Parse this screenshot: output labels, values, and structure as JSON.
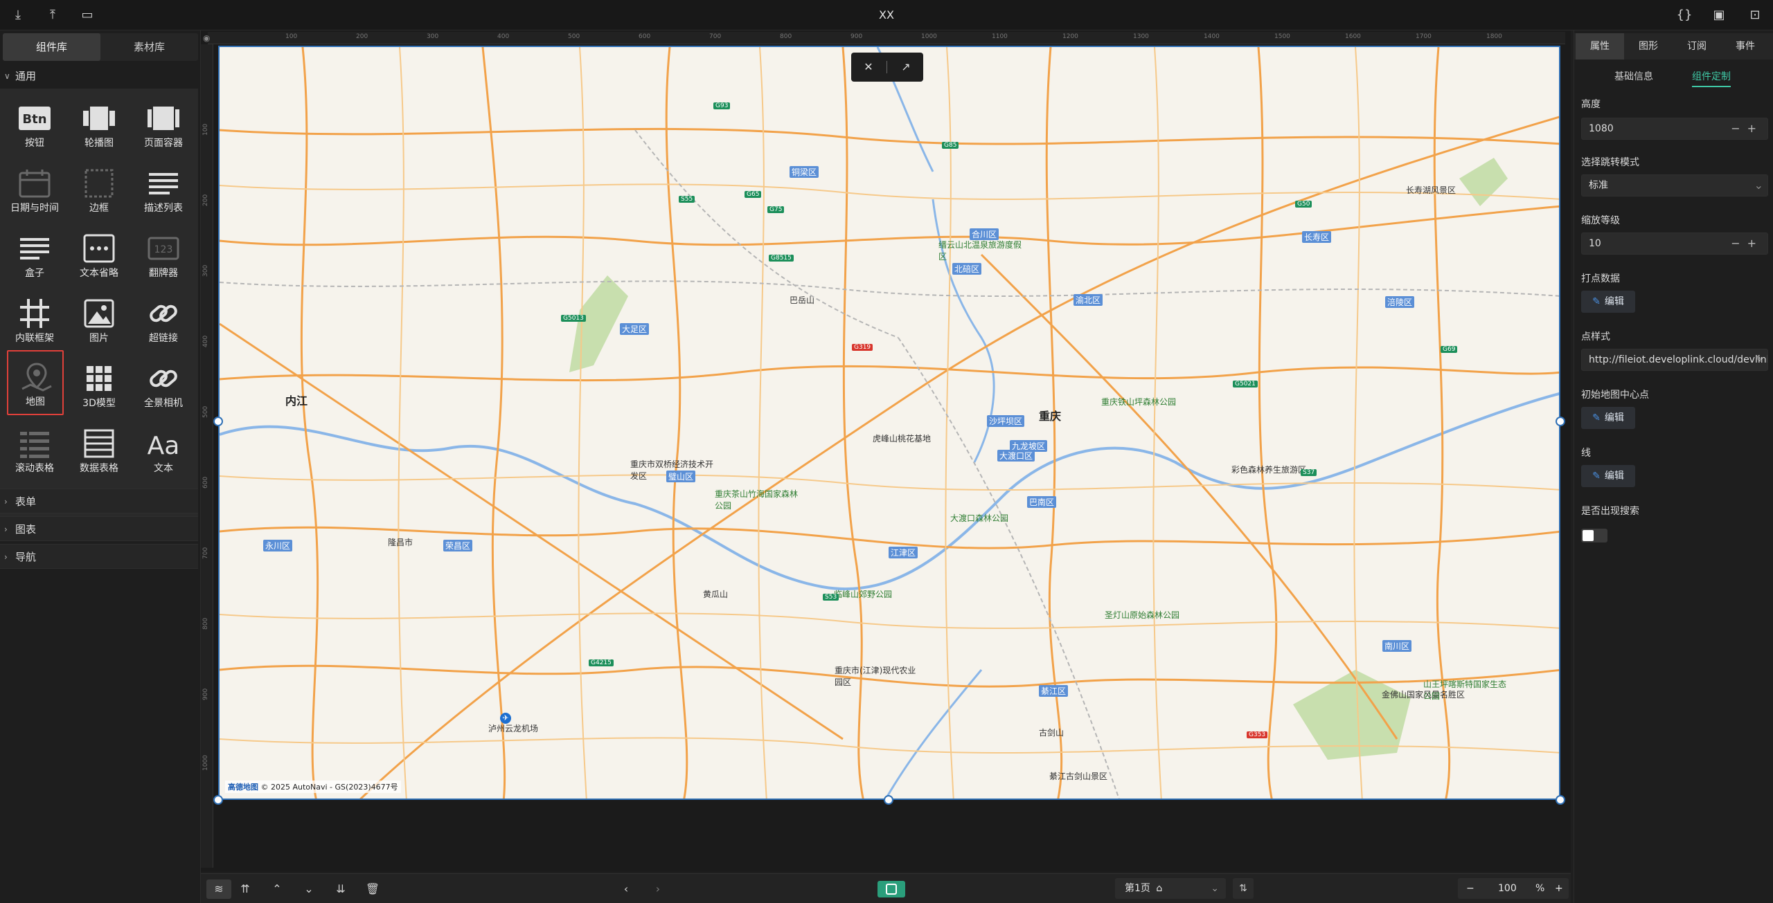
{
  "app": {
    "title": "XX"
  },
  "topbar": {
    "left_icons": [
      "download-icon",
      "upload-icon",
      "monitor-icon"
    ],
    "right_icons": [
      "code-icon",
      "save-icon",
      "export-icon"
    ]
  },
  "left_panel": {
    "tabs": [
      {
        "label": "组件库",
        "active": true
      },
      {
        "label": "素材库",
        "active": false
      }
    ],
    "sections": [
      {
        "label": "通用",
        "expanded": true
      },
      {
        "label": "表单",
        "expanded": false
      },
      {
        "label": "图表",
        "expanded": false
      },
      {
        "label": "导航",
        "expanded": false
      }
    ],
    "components": [
      {
        "label": "按钮",
        "icon": "btn-icon"
      },
      {
        "label": "轮播图",
        "icon": "carousel-icon"
      },
      {
        "label": "页面容器",
        "icon": "page-container-icon"
      },
      {
        "label": "日期与时间",
        "icon": "calendar-icon"
      },
      {
        "label": "边框",
        "icon": "border-icon"
      },
      {
        "label": "描述列表",
        "icon": "description-list-icon"
      },
      {
        "label": "盒子",
        "icon": "box-icon"
      },
      {
        "label": "文本省略",
        "icon": "ellipsis-icon"
      },
      {
        "label": "翻牌器",
        "icon": "flip-counter-icon"
      },
      {
        "label": "内联框架",
        "icon": "iframe-icon"
      },
      {
        "label": "图片",
        "icon": "image-icon"
      },
      {
        "label": "超链接",
        "icon": "link-icon"
      },
      {
        "label": "地图",
        "icon": "map-icon"
      },
      {
        "label": "3D模型",
        "icon": "grid-3d-icon"
      },
      {
        "label": "全景相机",
        "icon": "panorama-link-icon"
      },
      {
        "label": "滚动表格",
        "icon": "scroll-table-icon"
      },
      {
        "label": "数据表格",
        "icon": "data-table-icon"
      },
      {
        "label": "文本",
        "icon": "text-icon"
      }
    ]
  },
  "ruler": {
    "top_marks": [
      "100",
      "200",
      "300",
      "400",
      "500",
      "600",
      "700",
      "800",
      "900",
      "1000",
      "1100",
      "1200",
      "1300",
      "1400",
      "1500",
      "1600",
      "1700",
      "1800"
    ],
    "left_marks": [
      "100",
      "200",
      "300",
      "400",
      "500",
      "600",
      "700",
      "800",
      "900",
      "1000"
    ]
  },
  "map": {
    "attribution_logo": "高德地图",
    "attribution_text": "© 2025 AutoNavi - GS(2023)4677号",
    "toolbar_icons": [
      "no-flash-icon",
      "trend-icon"
    ],
    "places": [
      {
        "name": "重庆",
        "big": true
      },
      {
        "name": "内江",
        "big": true
      },
      {
        "name": "铜梁区"
      },
      {
        "name": "北碚区"
      },
      {
        "name": "合川区"
      },
      {
        "name": "永川区"
      },
      {
        "name": "沙坪坝区"
      },
      {
        "name": "九龙坡区"
      },
      {
        "name": "大渡口区"
      },
      {
        "name": "巴南区"
      },
      {
        "name": "江津区"
      },
      {
        "name": "渝北区"
      },
      {
        "name": "长寿区"
      },
      {
        "name": "涪陵区"
      },
      {
        "name": "南川区"
      },
      {
        "name": "大足区"
      },
      {
        "name": "璧山区"
      },
      {
        "name": "綦江区"
      },
      {
        "name": "荣昌区"
      },
      {
        "name": "隆昌市"
      },
      {
        "name": "泸州云龙机场"
      },
      {
        "name": "缙云山北温泉旅游度假区",
        "park": true
      },
      {
        "name": "重庆铁山坪森林公园",
        "park": true
      },
      {
        "name": "虎峰山桃花基地"
      },
      {
        "name": "重庆茶山竹海国家森林公园",
        "park": true
      },
      {
        "name": "重庆市双桥经济技术开发区"
      },
      {
        "name": "大渡口森林公园",
        "park": true
      },
      {
        "name": "彩色森林养生旅游区"
      },
      {
        "name": "临峰山郊野公园",
        "park": true
      },
      {
        "name": "重庆市(江津)现代农业园区"
      },
      {
        "name": "圣灯山原始森林公园",
        "park": true
      },
      {
        "name": "金佛山国家风景名胜区"
      },
      {
        "name": "山王坪喀斯特国家生态公园",
        "park": true
      },
      {
        "name": "綦江古剑山景区"
      },
      {
        "name": "长寿湖风景区"
      },
      {
        "name": "巴岳山"
      },
      {
        "name": "黄瓜山"
      },
      {
        "name": "古剑山"
      }
    ],
    "shields": [
      {
        "code": "G93"
      },
      {
        "code": "G85"
      },
      {
        "code": "G65"
      },
      {
        "code": "G75"
      },
      {
        "code": "G50"
      },
      {
        "code": "G69"
      },
      {
        "code": "S55"
      },
      {
        "code": "G5013"
      },
      {
        "code": "G8515"
      },
      {
        "code": "G319",
        "red": true
      },
      {
        "code": "S53"
      },
      {
        "code": "G4215"
      },
      {
        "code": "G353",
        "red": true
      },
      {
        "code": "S37"
      },
      {
        "code": "G5021"
      }
    ]
  },
  "bottom_bar": {
    "icons": [
      "layers-icon",
      "bring-to-front-icon",
      "bring-forward-icon",
      "send-backward-icon",
      "send-to-back-icon",
      "delete-icon"
    ],
    "page_label": "第1页",
    "zoom_value": "100",
    "zoom_unit": "%"
  },
  "right_panel": {
    "tabs": [
      {
        "label": "属性",
        "active": true
      },
      {
        "label": "图形"
      },
      {
        "label": "订阅"
      },
      {
        "label": "事件"
      }
    ],
    "subtabs": [
      {
        "label": "基础信息"
      },
      {
        "label": "组件定制",
        "active": true
      }
    ],
    "fields": {
      "height_label": "高度",
      "height_value": "1080",
      "jump_mode_label": "选择跳转模式",
      "jump_mode_value": "标准",
      "zoom_label": "缩放等级",
      "zoom_value": "10",
      "points_label": "打点数据",
      "edit_label": "编辑",
      "point_style_label": "点样式",
      "point_style_value": "http://fileiot.developlink.cloud/devlink",
      "center_label": "初始地图中心点",
      "line_label": "线",
      "search_label": "是否出现搜索"
    }
  },
  "colors": {
    "accent": "#3fc9a6",
    "selection": "#2e6fb5",
    "danger_border": "#e0403a",
    "preview": "#2a9e7b"
  }
}
